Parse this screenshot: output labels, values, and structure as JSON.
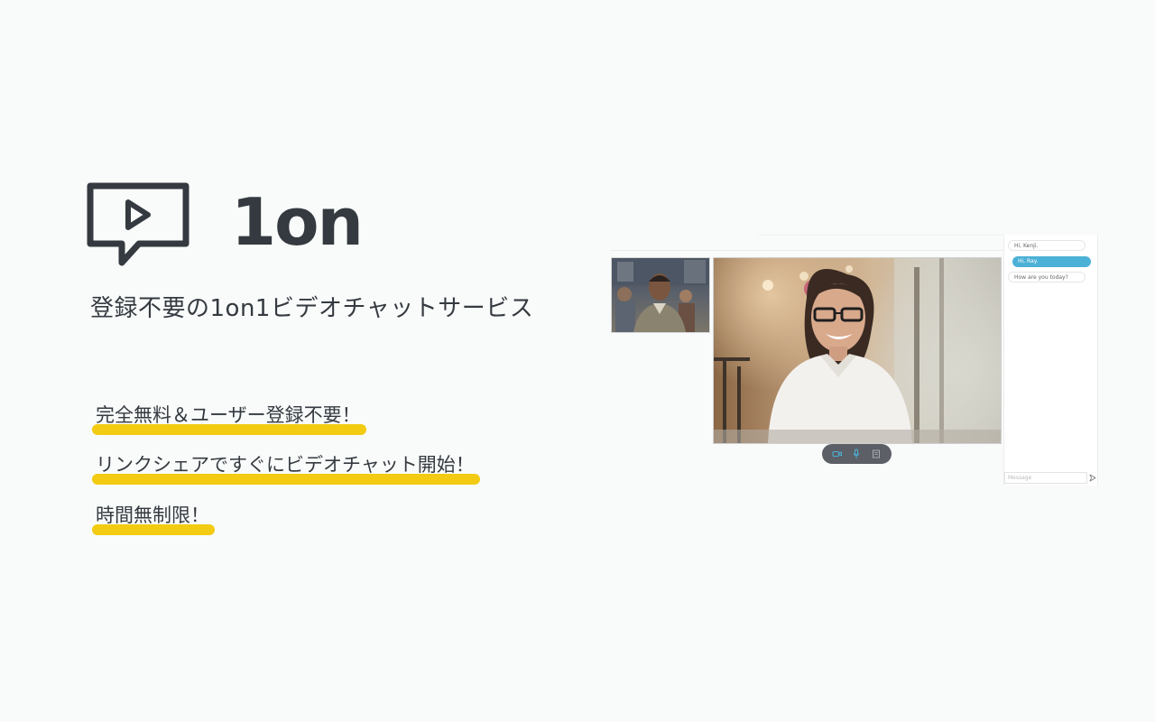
{
  "brand": {
    "logo_icon": "video-play-speech-bubble-icon",
    "name": "1on",
    "color": "#343a40"
  },
  "tagline": "登録不要の1on1ビデオチャットサービス",
  "features": [
    "完全無料＆ユーザー登録不要！",
    "リンクシェアですぐにビデオチャット開始！",
    "時間無制限！"
  ],
  "highlight_color": "#f2cb12",
  "preview": {
    "controls": [
      "camera-icon",
      "microphone-icon",
      "screen-share-icon"
    ],
    "chat": {
      "messages": [
        {
          "text": "Hi, Kenji.",
          "direction": "incoming"
        },
        {
          "text": "Hi, Ray.",
          "direction": "outgoing"
        },
        {
          "text": "How are you today?",
          "direction": "incoming"
        }
      ],
      "input_placeholder": "Message",
      "send_icon": "send-icon",
      "bubble_out_color": "#4cb1d6"
    }
  }
}
